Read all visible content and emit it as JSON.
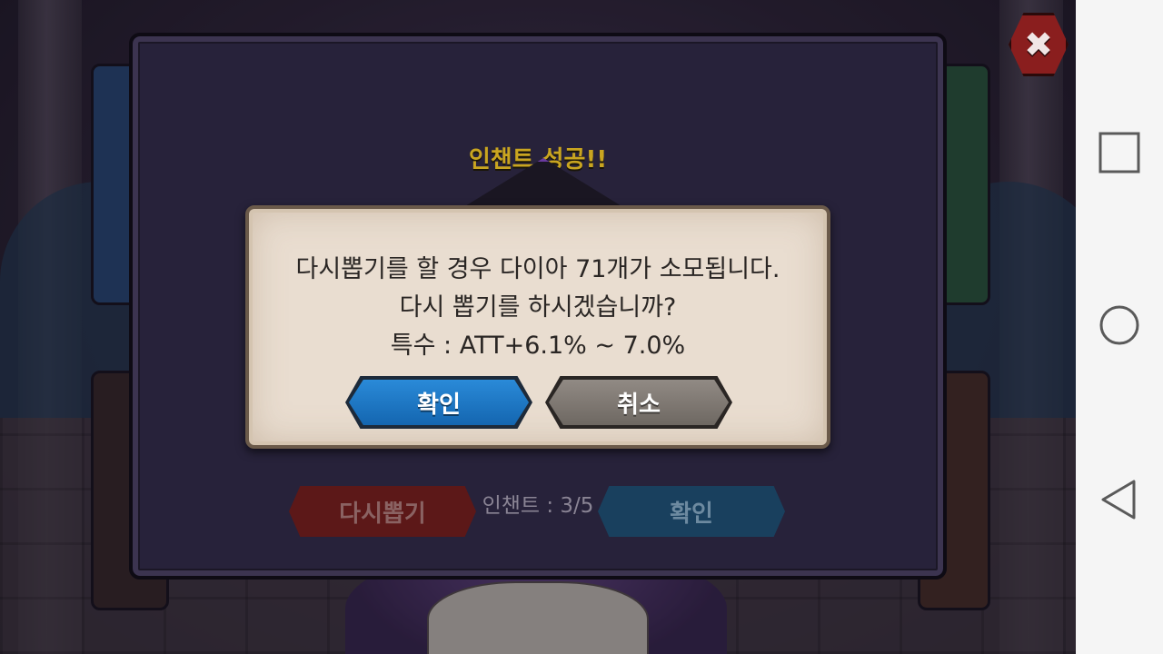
{
  "panel": {
    "title": "인챈트 성공!!",
    "enchant_count": "인챈트 : 3/5",
    "reroll_label": "다시뽑기",
    "confirm_label": "확인"
  },
  "close_button": {
    "icon": "close-icon",
    "glyph": "✖"
  },
  "dialog": {
    "message_line1": "다시뽑기를 할 경우 다이아 71개가 소모됩니다.",
    "message_line2": "다시 뽑기를 하시겠습니까?",
    "message_line3": "특수 : ATT+6.1% ~ 7.0%",
    "confirm_label": "확인",
    "cancel_label": "취소"
  },
  "navbar": {
    "recents_icon": "square-icon",
    "home_icon": "circle-icon",
    "back_icon": "triangle-back-icon"
  },
  "colors": {
    "title_gold": "#c9a520",
    "confirm_blue": "#1466b0",
    "cancel_gray": "#6e6862",
    "reroll_red": "#5c1818"
  }
}
